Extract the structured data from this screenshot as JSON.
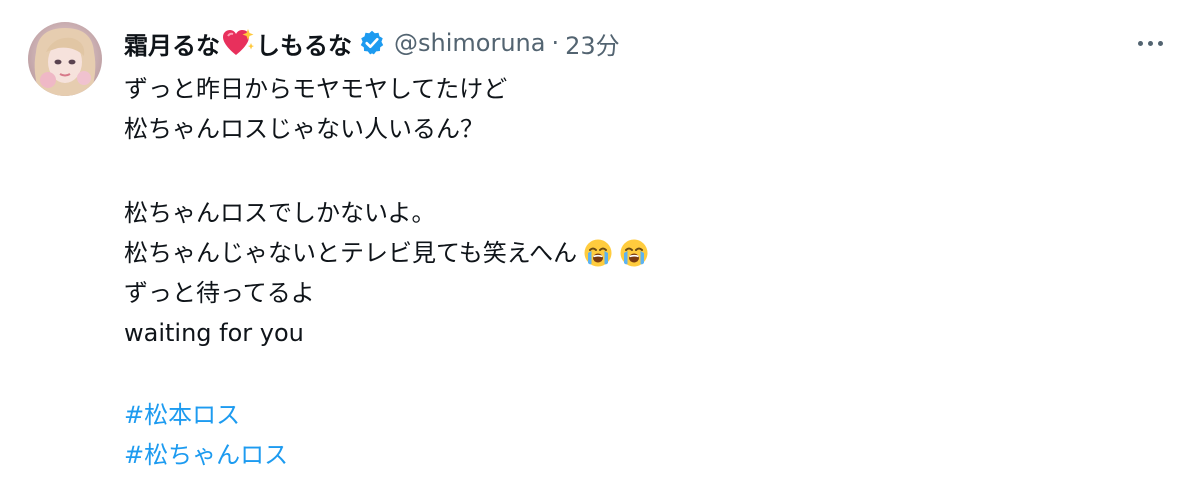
{
  "tweet": {
    "display_name": "霜月るな",
    "display_name_suffix": "しもるな",
    "handle": "@shimoruna",
    "separator": "·",
    "time_ago": "23分",
    "heart_icon": "sparkling-heart-icon",
    "verified_icon": "verified-badge-icon",
    "more_icon": "more-horizontal-icon",
    "lines": [
      "ずっと昨日からモヤモヤしてたけど",
      "松ちゃんロスじゃない人いるん？",
      "松ちゃんロスでしかないよ。",
      "松ちゃんじゃないとテレビ見ても笑えへん",
      "ずっと待ってるよ",
      "waiting for you"
    ],
    "emojis": [
      "loudly-crying-face-icon",
      "loudly-crying-face-icon"
    ],
    "hashtags": [
      "#松本ロス",
      "#松ちゃんロス"
    ]
  },
  "colors": {
    "text": "#0f1419",
    "secondary": "#536471",
    "link": "#1d9bf0",
    "verified": "#1d9bf0"
  }
}
